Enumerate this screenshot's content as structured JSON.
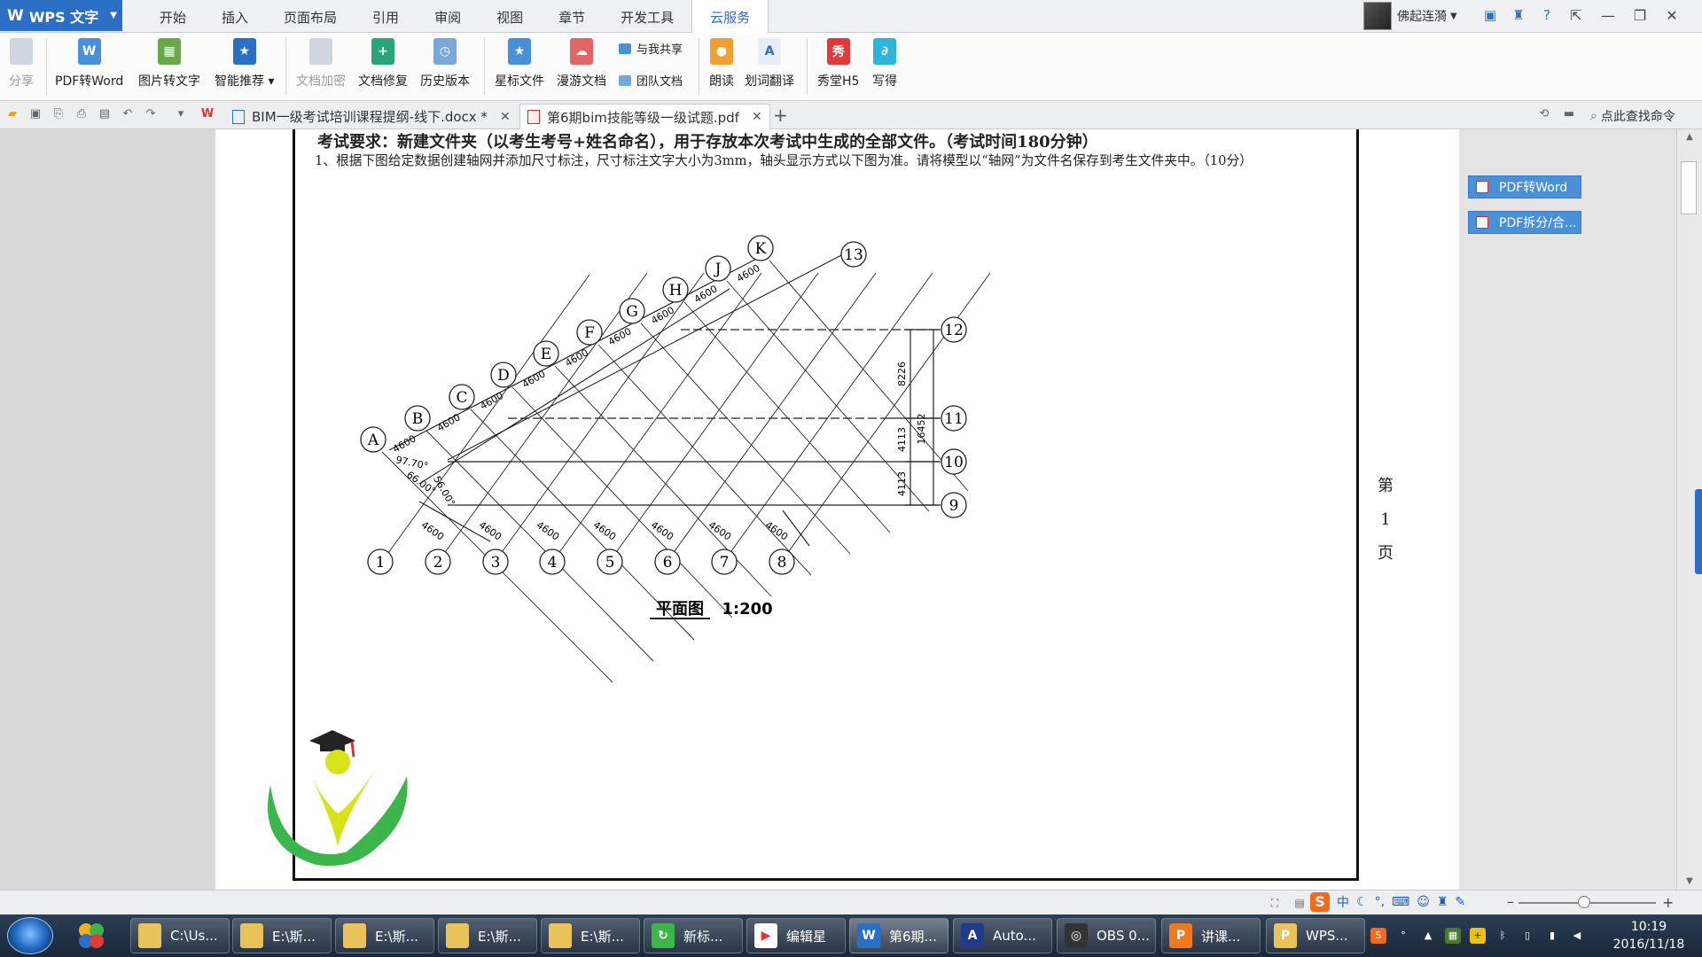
{
  "app": {
    "name": "WPS 文字",
    "logo_glyph": "W"
  },
  "menu": {
    "tabs": [
      "开始",
      "插入",
      "页面布局",
      "引用",
      "审阅",
      "视图",
      "章节",
      "开发工具",
      "云服务"
    ],
    "active_index": 8
  },
  "user": {
    "name": "佛起连漪"
  },
  "ribbon": {
    "share": "分享",
    "pdf_to_word": "PDF转Word",
    "image_to_text": "图片转文字",
    "smart_recommend": "智能推荐",
    "doc_encrypt": "文档加密",
    "doc_repair": "文档修复",
    "history": "历史版本",
    "star_file": "星标文件",
    "roam_doc": "漫游文档",
    "share_with_me": "与我共享",
    "team_doc": "团队文档",
    "read_aloud": "朗读",
    "translate": "划词翻译",
    "xiutang": "秀堂H5",
    "xiede": "写得"
  },
  "tabs": {
    "docx_title": "BIM一级考试培训课程提纲-线下.docx *",
    "pdf_title": "第6期bim技能等级一级试题.pdf",
    "search_cmd": "点此查找命令"
  },
  "document": {
    "requirement": "考试要求：新建文件夹（以考生考号+姓名命名），用于存放本次考试中生成的全部文件。（考试时间180分钟）",
    "question1": "1、根据下图给定数据创建轴网并添加尺寸标注，尺寸标注文字大小为3mm，轴头显示方式以下图为准。请将模型以“轴网”为文件名保存到考生文件夹中。（10分）",
    "page_label": [
      "第",
      "1",
      "页"
    ],
    "plan_title": "平面图",
    "plan_scale": "1:200",
    "diag_axes": [
      "A",
      "B",
      "C",
      "D",
      "E",
      "F",
      "G",
      "H",
      "J",
      "K"
    ],
    "bottom_axes": [
      "1",
      "2",
      "3",
      "4",
      "5",
      "6",
      "7",
      "8"
    ],
    "right_axes": [
      "12",
      "11",
      "10",
      "9"
    ],
    "top_axis": "13",
    "spacing": "4600",
    "dim_8226": "8226",
    "dim_4113": "4113",
    "dim_16452": "16452",
    "angle1": "97.70°",
    "angle2": "66.00°",
    "angle3": "56.00°"
  },
  "right_panel": {
    "btn1": "PDF转Word",
    "btn2": "PDF拆分/合..."
  },
  "ime": {
    "lang": "中"
  },
  "taskbar": {
    "tasks": [
      "C:\\Us...",
      "E:\\斯...",
      "E:\\斯...",
      "E:\\斯...",
      "E:\\斯...",
      "新标...",
      "编辑星",
      "第6期...",
      "Auto...",
      "OBS 0...",
      "讲课...",
      "WPS..."
    ],
    "time": "10:19",
    "date": "2016/11/18"
  },
  "colors": {
    "accent": "#2b6fc4",
    "pdf_red": "#d9383a",
    "folder": "#e8c25a",
    "logo_green": "#3cb54a",
    "logo_yellow": "#d6e31a"
  }
}
